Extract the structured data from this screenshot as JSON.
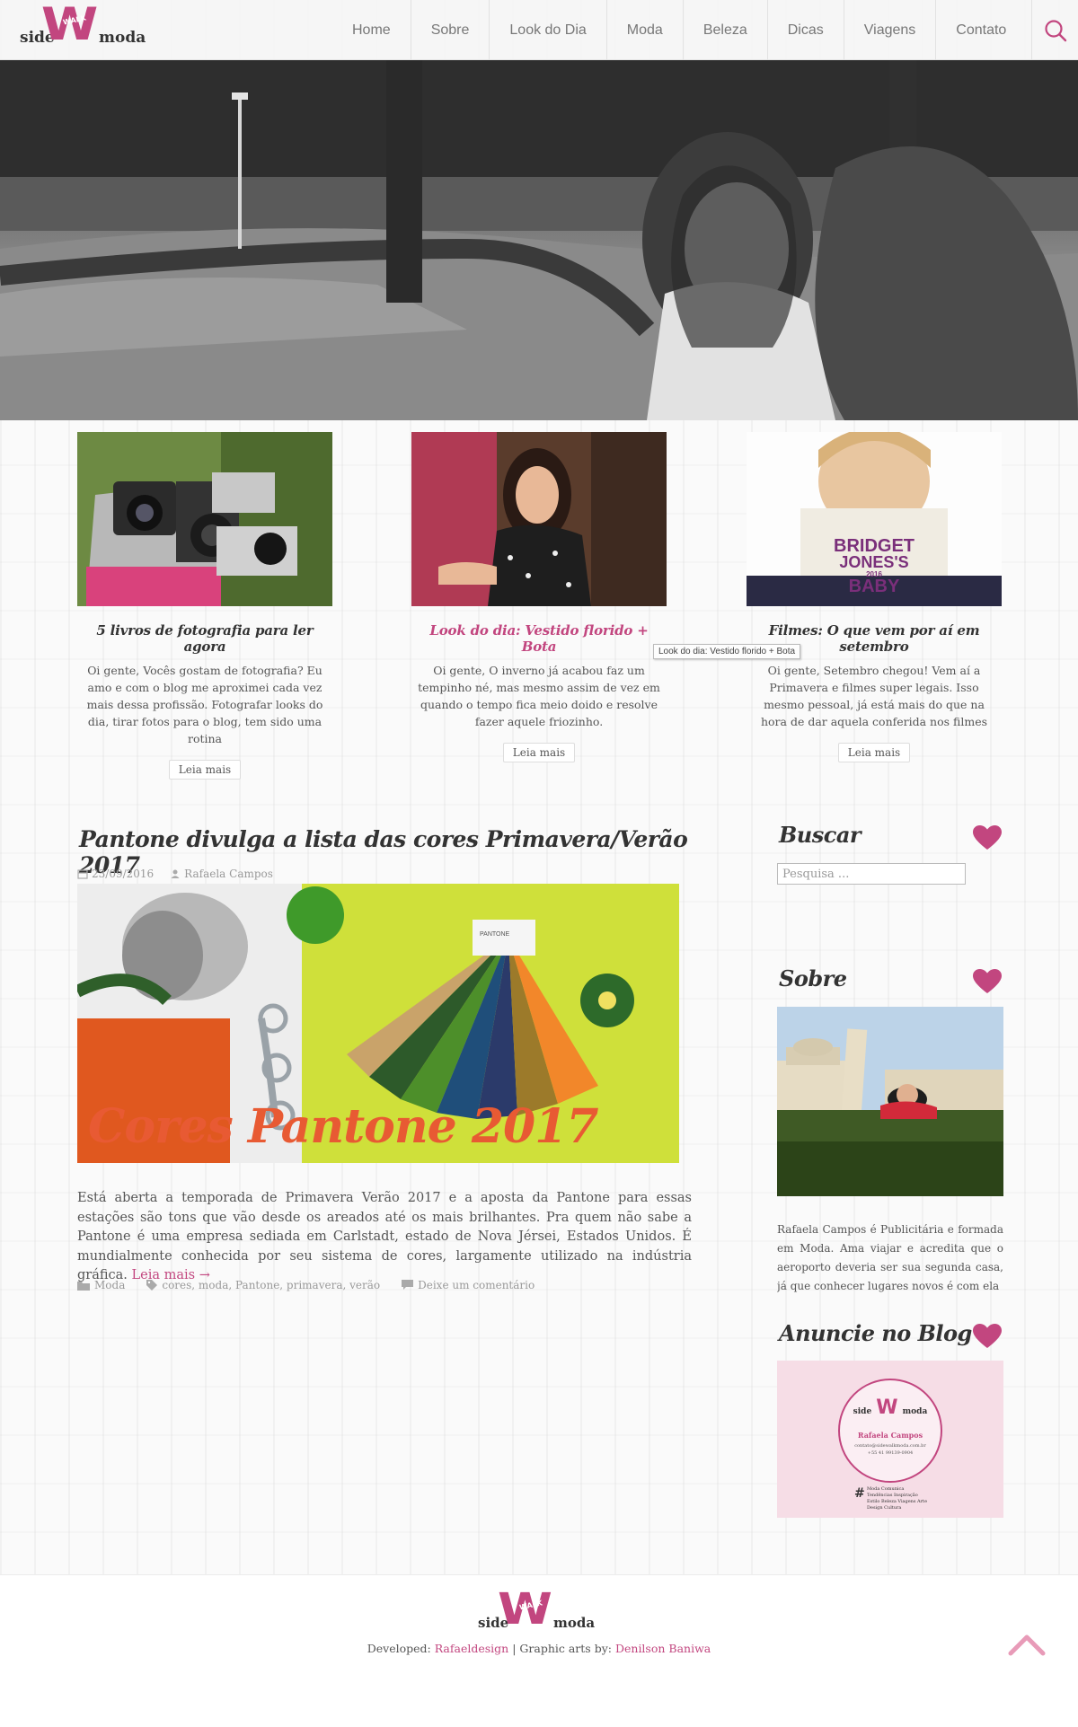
{
  "brand": {
    "side": "side",
    "walk": "WALK",
    "moda": "moda"
  },
  "nav": {
    "items": [
      "Home",
      "Sobre",
      "Look do Dia",
      "Moda",
      "Beleza",
      "Dicas",
      "Viagens",
      "Contato"
    ],
    "search_icon": "search-icon"
  },
  "featured": [
    {
      "title": "5 livros de fotografia para ler agora",
      "excerpt": "Oi gente, Vocês gostam de fotografia? Eu amo e com o blog me aproximei cada vez mais dessa profissão. Fotografar looks do dia, tirar fotos para o blog, tem sido uma rotina",
      "button": "Leia mais"
    },
    {
      "title": "Look do dia: Vestido florido + Bota",
      "excerpt": "Oi gente, O inverno já acabou faz um tempinho né, mas mesmo assim de vez em quando o tempo fica meio doido e resolve fazer aquele friozinho.",
      "button": "Leia mais"
    },
    {
      "title": "Filmes: O que vem por aí em setembro",
      "excerpt": "Oi gente, Setembro chegou! Vem aí a Primavera e filmes super legais. Isso mesmo pessoal, já está mais do que na hora de dar aquela conferida nos filmes",
      "button": "Leia mais",
      "poster_line1": "BRIDGET",
      "poster_line2": "JONES'S",
      "poster_year": "2016",
      "poster_line3": "BABY"
    }
  ],
  "tooltip": "Look do dia: Vestido florido + Bota",
  "post": {
    "title": "Pantone divulga a lista das cores Primavera/Verão 2017",
    "date": "23/09/2016",
    "author": "Rafaela Campos",
    "image_text": "Cores Pantone 2017",
    "swatch_label": "PANTONE",
    "body": "Está aberta a temporada de Primavera Verão 2017 e a aposta da Pantone para essas estações são tons que vão desde os areados até os mais brilhantes. Pra quem não sabe a Pantone é uma empresa sediada em Carlstadt, estado de Nova Jérsei, Estados Unidos. É mundialmente conhecida por seu sistema de cores, largamente utilizado na indústria gráfica.",
    "read_more": "Leia mais →",
    "category": "Moda",
    "tags": "cores, moda, Pantone, primavera, verão",
    "comments": "Deixe um comentário"
  },
  "sidebar": {
    "search_title": "Buscar",
    "search_placeholder": "Pesquisa ...",
    "about_title": "Sobre",
    "about_text": "Rafaela Campos é Publicitária e formada em Moda. Ama viajar e acredita que o aeroporto deveria ser sua segunda casa, já que conhecer lugares novos é com ela",
    "ad_title": "Anuncie no Blog",
    "ad_name": "Rafaela Campos",
    "ad_contact": "contato@sidewalkmoda.com.br",
    "ad_phone": "+55 41 99139-0904",
    "ad_hash": "#",
    "ad_tags": "Moda  Comunica  Tendências  Inspiração  Estilo  Beleza  Viagens  Arte  Design  Cultura"
  },
  "footer": {
    "developed_label": "Developed:",
    "developer": "Rafaeldesign",
    "separator": "|",
    "graphic_label": "Graphic arts by:",
    "artist": "Denilson Baniwa"
  },
  "colors": {
    "accent": "#c2467f",
    "text": "#555555",
    "heading": "#333333",
    "orange": "#e85a33"
  }
}
